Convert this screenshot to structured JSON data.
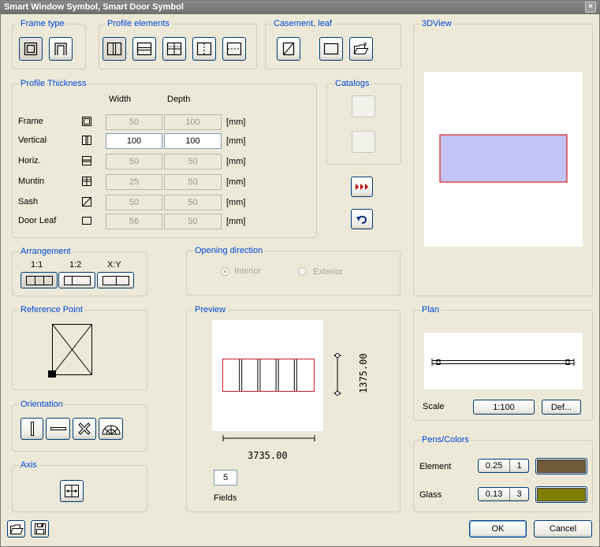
{
  "window": {
    "title": "Smart Window Symbol, Smart Door Symbol",
    "close": "×"
  },
  "groups": {
    "frame_type": "Frame type",
    "profile_elements": "Profile elements",
    "casement_leaf": "Casement, leaf",
    "view3d": "3DView",
    "profile_thickness": "Profile Thickness",
    "catalogs": "Catalogs",
    "arrangement": "Arrangement",
    "opening_direction": "Opening direction",
    "reference_point": "Reference Point",
    "preview": "Preview",
    "plan": "Plan",
    "orientation": "Orientation",
    "pens_colors": "Pens/Colors",
    "axis": "Axis"
  },
  "thickness": {
    "col_width": "Width",
    "col_depth": "Depth",
    "unit": "[mm]",
    "rows": [
      {
        "label": "Frame",
        "width": "50",
        "depth": "100",
        "enabled": false
      },
      {
        "label": "Vertical",
        "width": "100",
        "depth": "100",
        "enabled": true
      },
      {
        "label": "Horiz.",
        "width": "50",
        "depth": "50",
        "enabled": false
      },
      {
        "label": "Muntin",
        "width": "25",
        "depth": "50",
        "enabled": false
      },
      {
        "label": "Sash",
        "width": "50",
        "depth": "50",
        "enabled": false
      },
      {
        "label": "Door Leaf",
        "width": "56",
        "depth": "50",
        "enabled": false
      }
    ]
  },
  "arrangement": {
    "labels": [
      "1:1",
      "1:2",
      "X:Y"
    ]
  },
  "opening": {
    "interior": "Interior",
    "exterior": "Exterior",
    "selected": "interior"
  },
  "preview": {
    "width_dim": "3735.00",
    "height_dim": "1375.00",
    "fields_value": "5",
    "fields_label": "Fields"
  },
  "plan": {
    "scale_label": "Scale",
    "scale_value": "1:100",
    "def_button": "Def..."
  },
  "pens": {
    "element_label": "Element",
    "element_pen": "0.25",
    "element_num": "1",
    "element_color": "#6e5a38",
    "glass_label": "Glass",
    "glass_pen": "0.13",
    "glass_num": "3",
    "glass_color": "#808000"
  },
  "buttons": {
    "ok": "OK",
    "cancel": "Cancel"
  },
  "colors": {
    "view3d_fill": "#c3c3f5",
    "view3d_outline": "#e02020",
    "preview_outline": "#c81e1e",
    "group_title": "#0046d5"
  }
}
